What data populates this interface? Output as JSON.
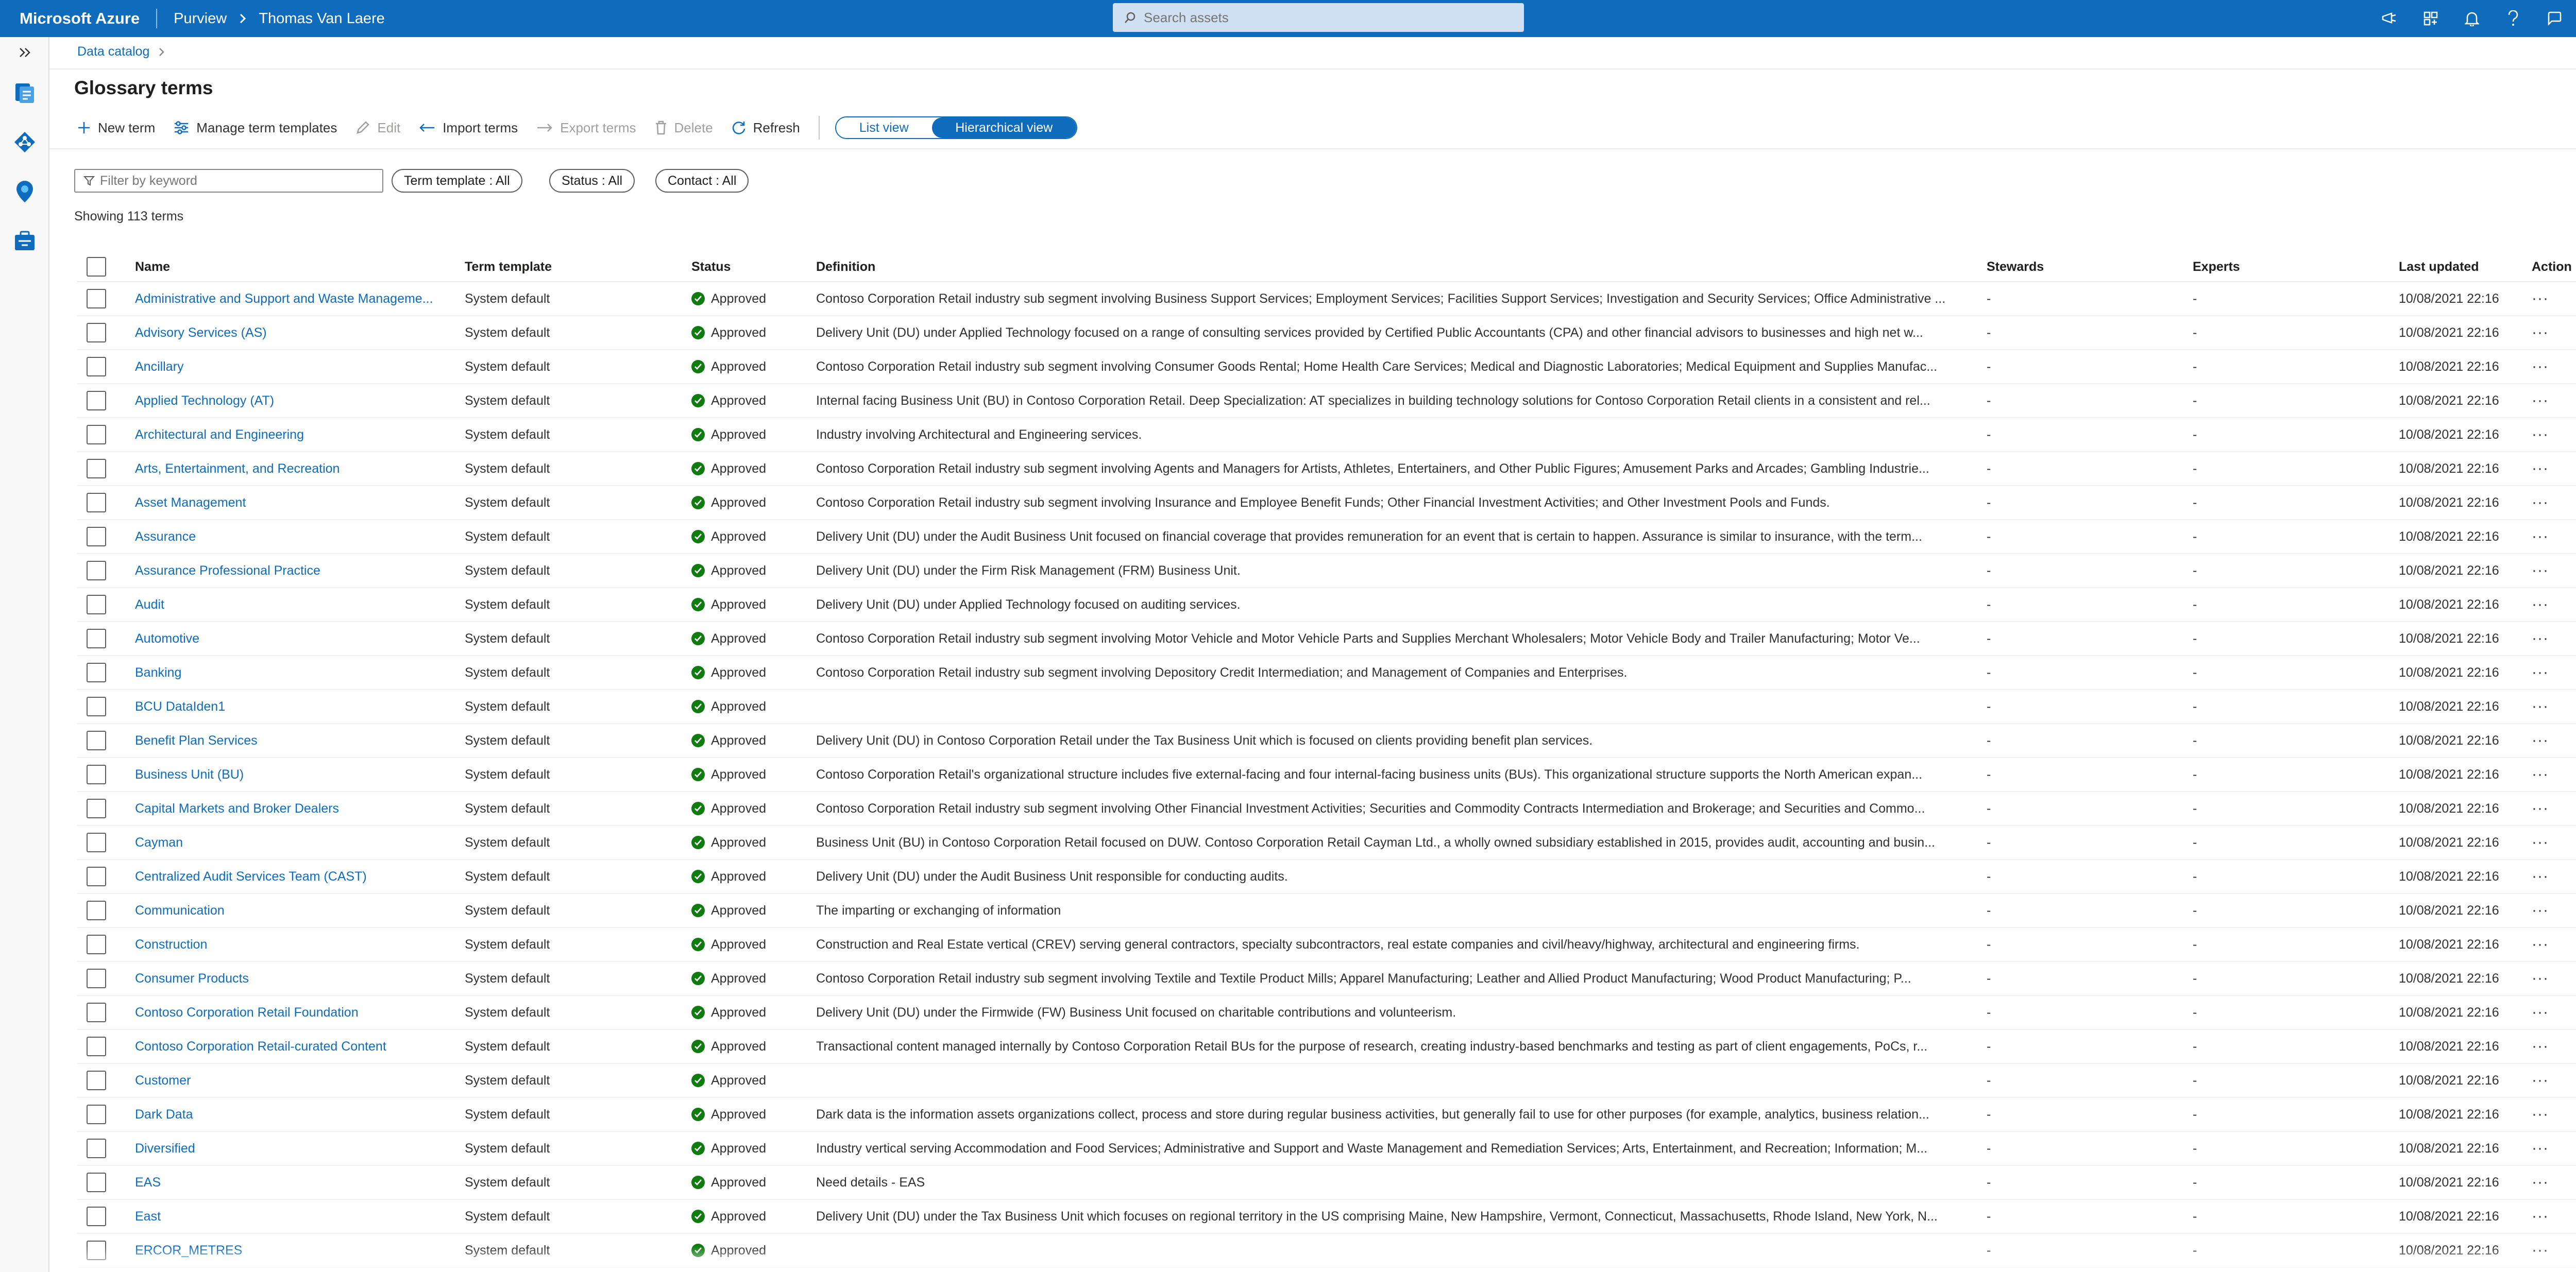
{
  "topbar": {
    "brand": "Microsoft Azure",
    "service": "Purview",
    "tenant": "Thomas Van Laere",
    "search_placeholder": "Search assets",
    "icons": [
      "feedback-icon",
      "directory-icon",
      "notifications-icon",
      "help-icon",
      "send-feedback-icon",
      "avatar"
    ]
  },
  "rail": {
    "items": [
      "expand-icon",
      "data-catalog-icon",
      "data-map-icon",
      "insights-icon",
      "management-icon"
    ]
  },
  "breadcrumb": {
    "item": "Data catalog"
  },
  "page": {
    "title": "Glossary terms"
  },
  "commands": {
    "new_term": "New term",
    "manage_templates": "Manage term templates",
    "edit": "Edit",
    "import_terms": "Import terms",
    "export_terms": "Export terms",
    "delete": "Delete",
    "refresh": "Refresh",
    "list_view": "List view",
    "hierarchical_view": "Hierarchical view"
  },
  "filters": {
    "keyword_placeholder": "Filter by keyword",
    "term_template": "Term template : All",
    "status": "Status : All",
    "contact": "Contact : All"
  },
  "summary": "Showing 113 terms",
  "table": {
    "columns": {
      "name": "Name",
      "template": "Term template",
      "status": "Status",
      "definition": "Definition",
      "stewards": "Stewards",
      "experts": "Experts",
      "last_updated": "Last updated",
      "action": "Action"
    },
    "rows": [
      {
        "name": "Administrative and Support and Waste Manageme...",
        "template": "System default",
        "status": "Approved",
        "definition": "Contoso Corporation Retail industry sub segment involving Business Support Services; Employment Services; Facilities Support Services; Investigation and Security Services; Office Administrative ...",
        "stewards": "-",
        "experts": "-",
        "updated": "10/08/2021 22:16"
      },
      {
        "name": "Advisory Services (AS)",
        "template": "System default",
        "status": "Approved",
        "definition": "Delivery Unit (DU) under Applied Technology focused on a range of consulting services provided by Certified Public Accountants (CPA) and other financial advisors to businesses and high net w...",
        "stewards": "-",
        "experts": "-",
        "updated": "10/08/2021 22:16"
      },
      {
        "name": "Ancillary",
        "template": "System default",
        "status": "Approved",
        "definition": "Contoso Corporation Retail industry sub segment involving Consumer Goods Rental; Home Health Care Services; Medical and Diagnostic Laboratories; Medical Equipment and Supplies Manufac...",
        "stewards": "-",
        "experts": "-",
        "updated": "10/08/2021 22:16"
      },
      {
        "name": "Applied Technology (AT)",
        "template": "System default",
        "status": "Approved",
        "definition": "Internal facing Business Unit (BU) in Contoso Corporation Retail. Deep Specialization: AT specializes in building technology solutions for Contoso Corporation Retail clients in a consistent and rel...",
        "stewards": "-",
        "experts": "-",
        "updated": "10/08/2021 22:16"
      },
      {
        "name": "Architectural and Engineering",
        "template": "System default",
        "status": "Approved",
        "definition": "Industry involving Architectural and Engineering services.",
        "stewards": "-",
        "experts": "-",
        "updated": "10/08/2021 22:16"
      },
      {
        "name": "Arts, Entertainment, and Recreation",
        "template": "System default",
        "status": "Approved",
        "definition": "Contoso Corporation Retail industry sub segment involving Agents and Managers for Artists, Athletes, Entertainers, and Other Public Figures; Amusement Parks and Arcades; Gambling Industrie...",
        "stewards": "-",
        "experts": "-",
        "updated": "10/08/2021 22:16"
      },
      {
        "name": "Asset Management",
        "template": "System default",
        "status": "Approved",
        "definition": "Contoso Corporation Retail industry sub segment involving Insurance and Employee Benefit Funds; Other Financial Investment Activities; and Other Investment Pools and Funds.",
        "stewards": "-",
        "experts": "-",
        "updated": "10/08/2021 22:16"
      },
      {
        "name": "Assurance",
        "template": "System default",
        "status": "Approved",
        "definition": "Delivery Unit (DU) under the Audit Business Unit focused on financial coverage that provides remuneration for an event that is certain to happen. Assurance is similar to insurance, with the term...",
        "stewards": "-",
        "experts": "-",
        "updated": "10/08/2021 22:16"
      },
      {
        "name": "Assurance Professional Practice",
        "template": "System default",
        "status": "Approved",
        "definition": "Delivery Unit (DU) under the Firm Risk Management (FRM) Business Unit.",
        "stewards": "-",
        "experts": "-",
        "updated": "10/08/2021 22:16"
      },
      {
        "name": "Audit",
        "template": "System default",
        "status": "Approved",
        "definition": "Delivery Unit (DU) under Applied Technology focused on auditing services.",
        "stewards": "-",
        "experts": "-",
        "updated": "10/08/2021 22:16"
      },
      {
        "name": "Automotive",
        "template": "System default",
        "status": "Approved",
        "definition": "Contoso Corporation Retail industry sub segment involving Motor Vehicle and Motor Vehicle Parts and Supplies Merchant Wholesalers; Motor Vehicle Body and Trailer Manufacturing; Motor Ve...",
        "stewards": "-",
        "experts": "-",
        "updated": "10/08/2021 22:16"
      },
      {
        "name": "Banking",
        "template": "System default",
        "status": "Approved",
        "definition": "Contoso Corporation Retail industry sub segment involving Depository Credit Intermediation; and Management of Companies and Enterprises.",
        "stewards": "-",
        "experts": "-",
        "updated": "10/08/2021 22:16"
      },
      {
        "name": "BCU DataIden1",
        "template": "System default",
        "status": "Approved",
        "definition": "",
        "stewards": "-",
        "experts": "-",
        "updated": "10/08/2021 22:16"
      },
      {
        "name": "Benefit Plan Services",
        "template": "System default",
        "status": "Approved",
        "definition": "Delivery Unit (DU) in Contoso Corporation Retail under the Tax Business Unit which is focused on clients providing benefit plan services.",
        "stewards": "-",
        "experts": "-",
        "updated": "10/08/2021 22:16"
      },
      {
        "name": "Business Unit (BU)",
        "template": "System default",
        "status": "Approved",
        "definition": "Contoso Corporation Retail's organizational structure includes five external-facing and four internal-facing business units (BUs). This organizational structure supports the North American expan...",
        "stewards": "-",
        "experts": "-",
        "updated": "10/08/2021 22:16"
      },
      {
        "name": "Capital Markets and Broker Dealers",
        "template": "System default",
        "status": "Approved",
        "definition": "Contoso Corporation Retail industry sub segment involving Other Financial Investment Activities; Securities and Commodity Contracts Intermediation and Brokerage; and Securities and Commo...",
        "stewards": "-",
        "experts": "-",
        "updated": "10/08/2021 22:16"
      },
      {
        "name": "Cayman",
        "template": "System default",
        "status": "Approved",
        "definition": "Business Unit (BU) in Contoso Corporation Retail focused on DUW. Contoso Corporation Retail Cayman Ltd., a wholly owned subsidiary established in 2015, provides audit, accounting and busin...",
        "stewards": "-",
        "experts": "-",
        "updated": "10/08/2021 22:16"
      },
      {
        "name": "Centralized Audit Services Team (CAST)",
        "template": "System default",
        "status": "Approved",
        "definition": "Delivery Unit (DU) under the Audit Business Unit responsible for conducting audits.",
        "stewards": "-",
        "experts": "-",
        "updated": "10/08/2021 22:16"
      },
      {
        "name": "Communication",
        "template": "System default",
        "status": "Approved",
        "definition": "The imparting or exchanging of information",
        "stewards": "-",
        "experts": "-",
        "updated": "10/08/2021 22:16"
      },
      {
        "name": "Construction",
        "template": "System default",
        "status": "Approved",
        "definition": "Construction and Real Estate vertical (CREV) serving general contractors, specialty subcontractors, real estate companies and civil/heavy/highway, architectural and engineering firms.",
        "stewards": "-",
        "experts": "-",
        "updated": "10/08/2021 22:16"
      },
      {
        "name": "Consumer Products",
        "template": "System default",
        "status": "Approved",
        "definition": "Contoso Corporation Retail industry sub segment involving Textile and Textile Product Mills; Apparel Manufacturing; Leather and Allied Product Manufacturing; Wood Product Manufacturing; P...",
        "stewards": "-",
        "experts": "-",
        "updated": "10/08/2021 22:16"
      },
      {
        "name": "Contoso Corporation Retail Foundation",
        "template": "System default",
        "status": "Approved",
        "definition": "Delivery Unit (DU) under the Firmwide (FW) Business Unit focused on charitable contributions and volunteerism.",
        "stewards": "-",
        "experts": "-",
        "updated": "10/08/2021 22:16"
      },
      {
        "name": "Contoso Corporation Retail-curated Content",
        "template": "System default",
        "status": "Approved",
        "definition": "Transactional content managed internally by Contoso Corporation Retail BUs for the purpose of research, creating industry-based benchmarks and testing as part of client engagements, PoCs, r...",
        "stewards": "-",
        "experts": "-",
        "updated": "10/08/2021 22:16"
      },
      {
        "name": "Customer",
        "template": "System default",
        "status": "Approved",
        "definition": "",
        "stewards": "-",
        "experts": "-",
        "updated": "10/08/2021 22:16"
      },
      {
        "name": "Dark Data",
        "template": "System default",
        "status": "Approved",
        "definition": "Dark data is the information assets organizations collect, process and store during regular business activities, but generally fail to use for other purposes (for example, analytics, business relation...",
        "stewards": "-",
        "experts": "-",
        "updated": "10/08/2021 22:16"
      },
      {
        "name": "Diversified",
        "template": "System default",
        "status": "Approved",
        "definition": "Industry vertical serving Accommodation and Food Services; Administrative and Support and Waste Management and Remediation Services; Arts, Entertainment, and Recreation; Information; M...",
        "stewards": "-",
        "experts": "-",
        "updated": "10/08/2021 22:16"
      },
      {
        "name": "EAS",
        "template": "System default",
        "status": "Approved",
        "definition": "Need details - EAS",
        "stewards": "-",
        "experts": "-",
        "updated": "10/08/2021 22:16"
      },
      {
        "name": "East",
        "template": "System default",
        "status": "Approved",
        "definition": "Delivery Unit (DU) under the Tax Business Unit which focuses on regional territory in the US comprising Maine, New Hampshire, Vermont, Connecticut, Massachusetts, Rhode Island, New York, N...",
        "stewards": "-",
        "experts": "-",
        "updated": "10/08/2021 22:16"
      },
      {
        "name": "ERCOR_METRES",
        "template": "System default",
        "status": "Approved",
        "definition": "",
        "stewards": "-",
        "experts": "-",
        "updated": "10/08/2021 22:16"
      }
    ]
  },
  "colors": {
    "accent": "#0f6cbd",
    "approved": "#107c10"
  }
}
